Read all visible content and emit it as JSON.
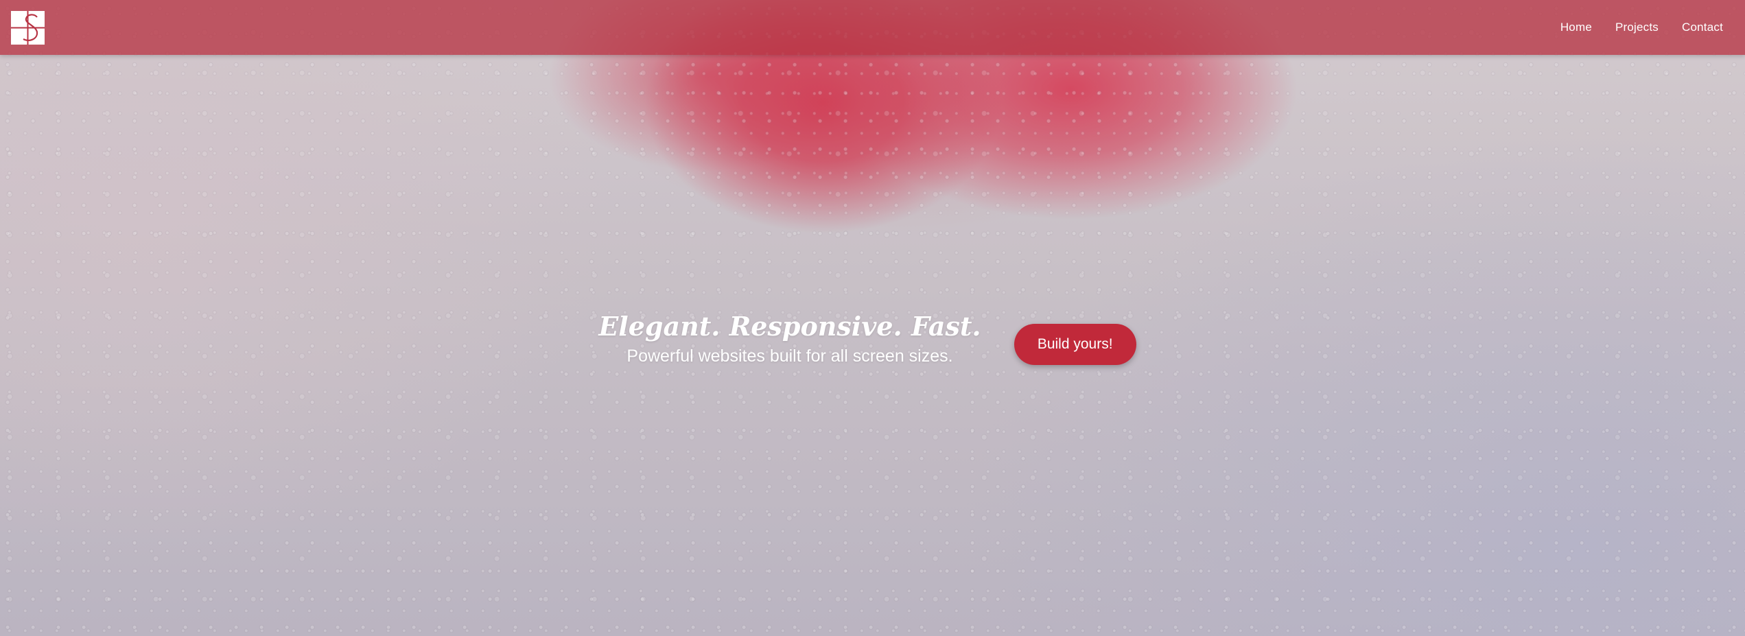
{
  "brand": {
    "logo_icon": "s-monogram-logo-icon",
    "colors": {
      "nav": "#b73444",
      "accent": "#c1293a",
      "text": "#ffffff"
    }
  },
  "nav": {
    "items": [
      {
        "label": "Home"
      },
      {
        "label": "Projects"
      },
      {
        "label": "Contact"
      }
    ]
  },
  "hero": {
    "title": "Elegant. Responsive. Fast.",
    "subtitle": "Powerful websites built for all screen sizes.",
    "cta_label": "Build yours!"
  }
}
